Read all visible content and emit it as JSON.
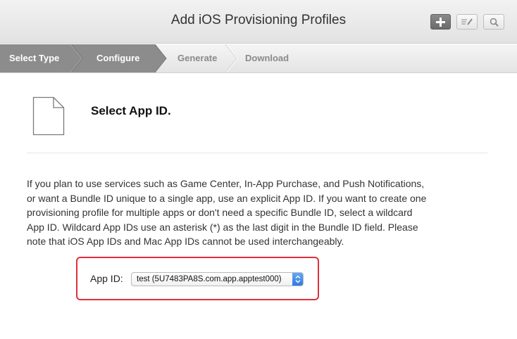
{
  "header": {
    "title": "Add iOS Provisioning Profiles",
    "add_icon": "plus-icon",
    "edit_icon": "edit-icon",
    "search_icon": "search-icon"
  },
  "steps": [
    {
      "label": "Select Type",
      "state": "done"
    },
    {
      "label": "Configure",
      "state": "current"
    },
    {
      "label": "Generate",
      "state": "todo"
    },
    {
      "label": "Download",
      "state": "todo"
    }
  ],
  "main": {
    "icon": "document-icon",
    "title": "Select App ID.",
    "description_lines": [
      "If you plan to use services such as Game Center, In-App Purchase, and Push Notifications,",
      "or want a Bundle ID unique to a single app, use an explicit App ID. If you want to create one",
      "provisioning profile for multiple apps or don't need a specific Bundle ID, select a wildcard",
      "App ID. Wildcard App IDs use an asterisk (*) as the last digit in the Bundle ID field. Please",
      "note that iOS App IDs and Mac App IDs cannot be used interchangeably."
    ],
    "app_id_label": "App ID:",
    "app_id_value": "test (5U7483PA8S.com.app.apptest000)"
  },
  "colors": {
    "steps_done": "#8c8c8c",
    "highlight_border": "#e0303b",
    "select_accent": "#2a78e4"
  }
}
